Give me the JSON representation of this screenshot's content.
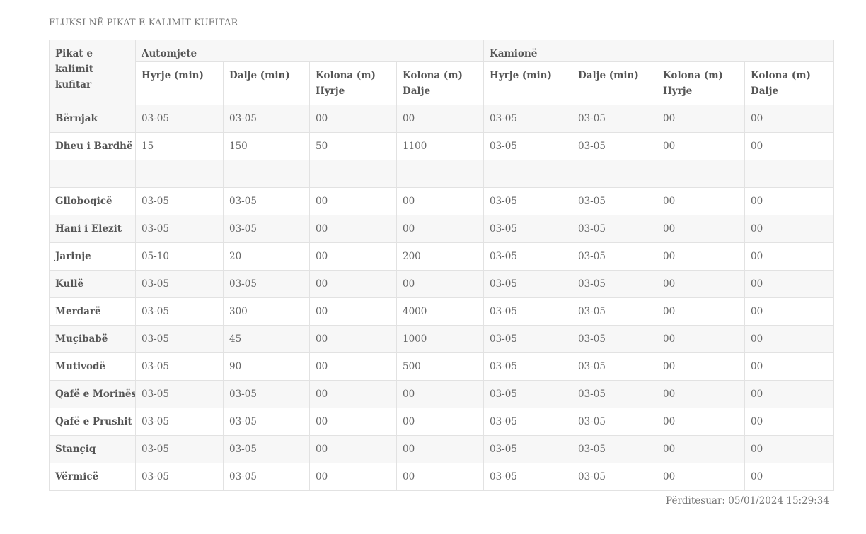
{
  "page": {
    "title": "FLUKSI NË PIKAT E KALIMIT KUFITAR",
    "updated": "Përditesuar: 05/01/2024 15:29:34"
  },
  "table": {
    "corner_header": "Pikat e kalimit kufitar",
    "groups": [
      "Automjete",
      "Kamionë"
    ],
    "subheaders": [
      "Hyrje (min)",
      "Dalje (min)",
      "Kolona (m) Hyrje",
      "Kolona (m) Dalje",
      "Hyrje (min)",
      "Dalje (min)",
      "Kolona (m) Hyrje",
      "Kolona (m) Dalje"
    ],
    "rows": [
      {
        "name": "Bërnjak",
        "values": [
          "03-05",
          "03-05",
          "00",
          "00",
          "03-05",
          "03-05",
          "00",
          "00"
        ]
      },
      {
        "name": "Dheu i Bardhë",
        "values": [
          "15",
          "150",
          "50",
          "1100",
          "03-05",
          "03-05",
          "00",
          "00"
        ]
      },
      {
        "name": "",
        "values": [
          "",
          "",
          "",
          "",
          "",
          "",
          "",
          ""
        ]
      },
      {
        "name": "Glloboqicë",
        "values": [
          "03-05",
          "03-05",
          "00",
          "00",
          "03-05",
          "03-05",
          "00",
          "00"
        ]
      },
      {
        "name": "Hani i Elezit",
        "values": [
          "03-05",
          "03-05",
          "00",
          "00",
          "03-05",
          "03-05",
          "00",
          "00"
        ]
      },
      {
        "name": "Jarinje",
        "values": [
          "05-10",
          "20",
          "00",
          "200",
          "03-05",
          "03-05",
          "00",
          "00"
        ]
      },
      {
        "name": "Kullë",
        "values": [
          "03-05",
          "03-05",
          "00",
          "00",
          "03-05",
          "03-05",
          "00",
          "00"
        ]
      },
      {
        "name": "Merdarë",
        "values": [
          "03-05",
          "300",
          "00",
          "4000",
          "03-05",
          "03-05",
          "00",
          "00"
        ]
      },
      {
        "name": "Muçibabë",
        "values": [
          "03-05",
          "45",
          "00",
          "1000",
          "03-05",
          "03-05",
          "00",
          "00"
        ]
      },
      {
        "name": "Mutivodë",
        "values": [
          "03-05",
          "90",
          "00",
          "500",
          "03-05",
          "03-05",
          "00",
          "00"
        ]
      },
      {
        "name": "Qafë e Morinës",
        "values": [
          "03-05",
          "03-05",
          "00",
          "00",
          "03-05",
          "03-05",
          "00",
          "00"
        ]
      },
      {
        "name": "Qafë e Prushit",
        "values": [
          "03-05",
          "03-05",
          "00",
          "00",
          "03-05",
          "03-05",
          "00",
          "00"
        ]
      },
      {
        "name": "Stançiq",
        "values": [
          "03-05",
          "03-05",
          "00",
          "00",
          "03-05",
          "03-05",
          "00",
          "00"
        ]
      },
      {
        "name": "Vërmicë",
        "values": [
          "03-05",
          "03-05",
          "00",
          "00",
          "03-05",
          "03-05",
          "00",
          "00"
        ]
      }
    ]
  }
}
